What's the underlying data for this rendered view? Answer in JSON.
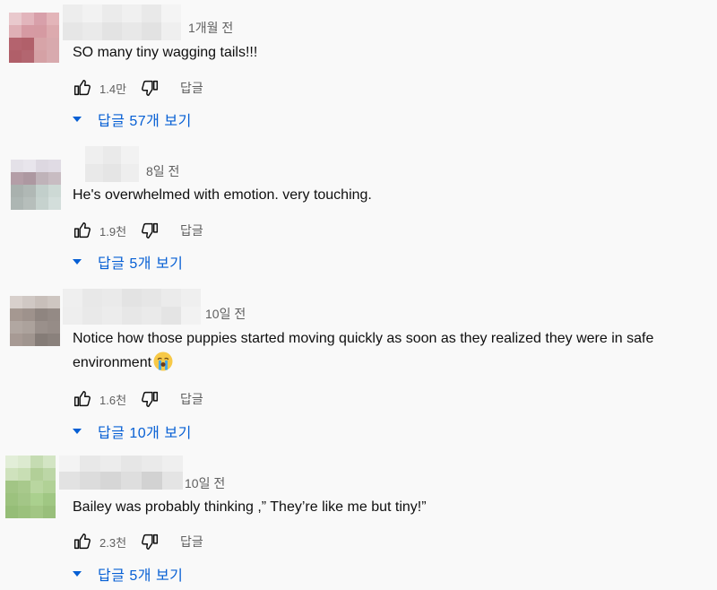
{
  "comments": [
    {
      "time": "1개월 전",
      "text": "SO many tiny wagging tails!!!",
      "likes": "1.4만",
      "reply_label": "답글",
      "replies_label": "답글 57개 보기",
      "avatar_colors": [
        "#e7c0c6",
        "#d8a0aa",
        "#c58890",
        "#e3b5b9",
        "#b15e6a",
        "#c07078",
        "#d79aa0",
        "#d8a9ad"
      ],
      "name_colors": [
        "#ececec",
        "#f1f1f1",
        "#e4e4e4"
      ]
    },
    {
      "time": "8일 전",
      "text": "He's overwhelmed with emotion. very touching.",
      "likes": "1.9천",
      "reply_label": "답글",
      "replies_label": "답글 5개 보기",
      "avatar_colors": [
        "#e6e3ea",
        "#d7d2dc",
        "#b39da6",
        "#c0b4ba",
        "#a8b0ad",
        "#c2cfcb",
        "#b6c2be",
        "#d5dfdc"
      ],
      "name_colors": [
        "#eeeeee",
        "#f3f3f3",
        "#e8e8e8"
      ]
    },
    {
      "time": "10일 전",
      "text": "Notice how those puppies started moving quickly as soon as they realized they were in safe environment",
      "likes": "1.6천",
      "reply_label": "답글",
      "replies_label": "답글 10개 보기",
      "avatar_colors": [
        "#d8d0cc",
        "#c8bfba",
        "#a59891",
        "#8f8580",
        "#b1a7a1",
        "#9a908b",
        "#a79a94",
        "#857c77"
      ],
      "name_colors": [
        "#eeeeee",
        "#e6e6e6",
        "#efefef"
      ]
    },
    {
      "time": "10일 전",
      "text": "Bailey was probably thinking ,” They’re like me but tiny!”",
      "likes": "2.3천",
      "reply_label": "답글",
      "replies_label": "답글 5개 보기",
      "avatar_colors": [
        "#dcead0",
        "#c5dcb2",
        "#b2cf98",
        "#a2c585",
        "#b9d6a0",
        "#9cc27e",
        "#aad08e",
        "#95bd77"
      ],
      "name_colors": [
        "#e8e8e8",
        "#dcdcdc",
        "#e4e4e4"
      ]
    }
  ],
  "icons": {
    "like": "thumbs-up-icon",
    "dislike": "thumbs-down-icon",
    "expand": "caret-down-icon",
    "emoji": "crying-face-emoji"
  },
  "accent": "#065fd4"
}
